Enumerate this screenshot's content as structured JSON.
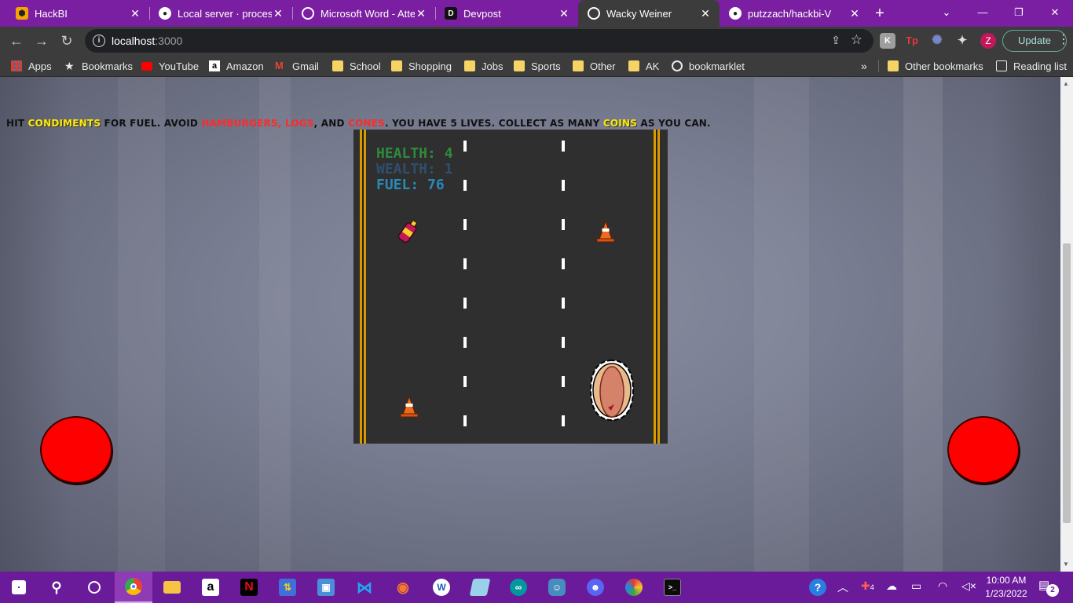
{
  "browser": {
    "tabs": [
      {
        "title": "HackBI",
        "favicon": "hackbi-favicon",
        "active": false
      },
      {
        "title": "Local server · processin",
        "favicon": "github-icon",
        "active": false
      },
      {
        "title": "Microsoft Word - Atte",
        "favicon": "globe-icon",
        "active": false
      },
      {
        "title": "Devpost",
        "favicon": "devpost-icon",
        "active": false
      },
      {
        "title": "Wacky Weiner",
        "favicon": "globe-icon",
        "active": true
      },
      {
        "title": "putzzach/hackbi-V",
        "favicon": "github-icon",
        "active": false
      }
    ],
    "new_tab_label": "+",
    "window_controls": [
      "⌄",
      "—",
      "❐",
      "✕"
    ],
    "url_host": "localhost",
    "url_port": ":3000",
    "update_label": "Update",
    "profile_initial": "Z",
    "extensions": [
      "K",
      "Tp",
      "✺",
      "✦"
    ]
  },
  "bookmarks": {
    "items": [
      {
        "label": "Apps",
        "icon": "apps-grid-icon"
      },
      {
        "label": "Bookmarks",
        "icon": "star-icon"
      },
      {
        "label": "YouTube",
        "icon": "youtube-icon"
      },
      {
        "label": "Amazon",
        "icon": "amazon-icon"
      },
      {
        "label": "Gmail",
        "icon": "gmail-icon"
      },
      {
        "label": "School",
        "icon": "folder-icon"
      },
      {
        "label": "Shopping",
        "icon": "folder-icon"
      },
      {
        "label": "Jobs",
        "icon": "folder-icon"
      },
      {
        "label": "Sports",
        "icon": "folder-icon"
      },
      {
        "label": "Other",
        "icon": "folder-icon"
      },
      {
        "label": "AK",
        "icon": "folder-icon"
      },
      {
        "label": "bookmarklet",
        "icon": "globe-icon"
      }
    ],
    "overflow_label": "»",
    "other_bookmarks": "Other bookmarks",
    "reading_list": "Reading list"
  },
  "game": {
    "instructions": {
      "p1": "Hit ",
      "condiments": "condiments",
      "p2": " for fuel. Avoid ",
      "hamburgers": "hamburgers",
      "comma1": ", ",
      "logs": "logs",
      "p3": ", and ",
      "cones": "cones",
      "p4": ". You have 5 lives. Collect as many ",
      "coins": "coins",
      "p5": " as you can."
    },
    "hud": {
      "health": "HEALTH: 4",
      "wealth": "WEALTH: 1",
      "fuel": "FUEL: 76"
    },
    "colors": {
      "health": "#2e8b3c",
      "wealth": "#2f4f6f",
      "fuel": "#2a8ab8",
      "road": "#2f2f2f",
      "road_edge": "#d99a00",
      "button": "#ff0000"
    }
  },
  "taskbar": {
    "apps": [
      "start-icon",
      "search-icon",
      "task-view-icon",
      "chrome-icon",
      "file-explorer-icon",
      "amazon-icon",
      "netflix-icon",
      "network-app-icon",
      "remote-desktop-icon",
      "vscode-icon",
      "blender-icon",
      "word-app-icon",
      "notes-icon",
      "arduino-icon",
      "godot-icon",
      "discord-icon",
      "paint-icon",
      "terminal-icon"
    ],
    "time": "10:00 AM",
    "date": "1/23/2022",
    "notification_count": "2",
    "tray_badge": "4"
  }
}
